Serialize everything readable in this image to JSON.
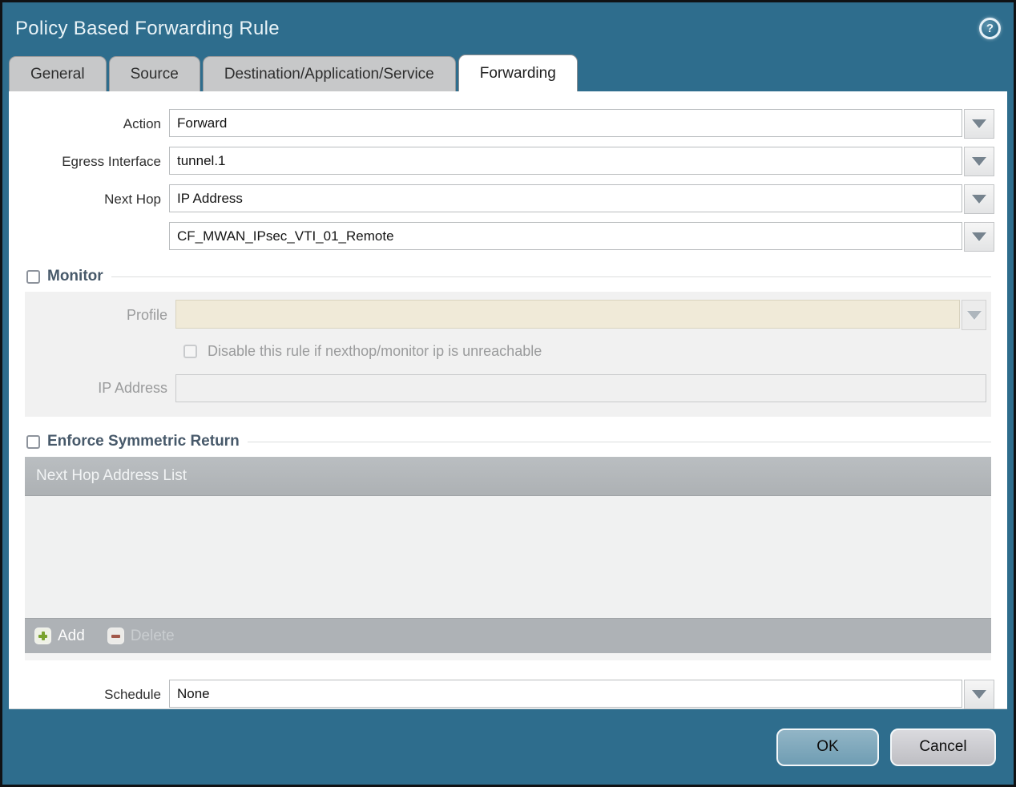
{
  "window": {
    "title": "Policy Based Forwarding Rule"
  },
  "tabs": [
    {
      "label": "General",
      "active": false
    },
    {
      "label": "Source",
      "active": false
    },
    {
      "label": "Destination/Application/Service",
      "active": false
    },
    {
      "label": "Forwarding",
      "active": true
    }
  ],
  "form": {
    "action": {
      "label": "Action",
      "value": "Forward"
    },
    "egress_interface": {
      "label": "Egress Interface",
      "value": "tunnel.1"
    },
    "next_hop": {
      "label": "Next Hop",
      "value": "IP Address"
    },
    "next_hop_address": {
      "value": "CF_MWAN_IPsec_VTI_01_Remote"
    },
    "schedule": {
      "label": "Schedule",
      "value": "None"
    }
  },
  "monitor": {
    "label": "Monitor",
    "checked": false,
    "profile": {
      "label": "Profile",
      "value": ""
    },
    "disable_rule": {
      "label": "Disable this rule if nexthop/monitor ip is unreachable",
      "checked": false
    },
    "ip_address": {
      "label": "IP Address",
      "value": ""
    }
  },
  "symmetric_return": {
    "label": "Enforce Symmetric Return",
    "checked": false,
    "table": {
      "header": "Next Hop Address List",
      "rows": []
    },
    "add_label": "Add",
    "delete_label": "Delete"
  },
  "footer": {
    "ok_label": "OK",
    "cancel_label": "Cancel"
  },
  "colors": {
    "titlebar_teal": "#2e6d8d",
    "active_tab": "#ffffff",
    "inactive_tab": "#c7c8c9",
    "section_label": "#47596a",
    "disabled_field_beige": "#f0ead8",
    "table_header_gray": "#b3b7ba",
    "add_green": "#7aa22e",
    "delete_red": "#a2584a",
    "ok_button_blue": "#7ca7bb",
    "cancel_button_gray": "#c9c9cd"
  }
}
